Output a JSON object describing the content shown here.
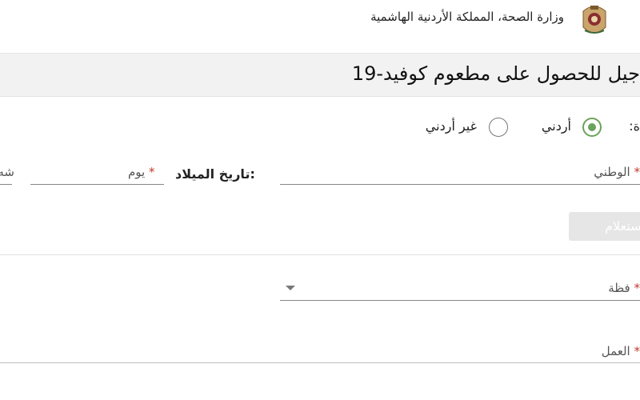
{
  "header": {
    "ministry": "وزارة الصحة، المملكة الأردنية الهاشمية",
    "logo_icon": "jordan-crest-icon"
  },
  "page_title": "جيل للحصول على مطعوم كوفيد-19",
  "nationality": {
    "label": "ة:",
    "options": [
      {
        "label": "أردني",
        "selected": true
      },
      {
        "label": "غير أردني",
        "selected": false
      }
    ]
  },
  "fields": {
    "national_id": {
      "label": "الوطني",
      "required_mark": "*"
    },
    "dob": {
      "label": "تاريخ الميلاد:",
      "day": {
        "label": "يوم",
        "required_mark": "*"
      },
      "month": {
        "label": "شه"
      }
    },
    "inquiry_button": "استعلام",
    "governorate": {
      "label": "فظة",
      "required_mark": "*"
    },
    "work": {
      "label": "العمل",
      "required_mark": "*"
    }
  },
  "colors": {
    "accent": "#6aa35a",
    "required": "#c0392b",
    "title_band": "#f2f2f2"
  }
}
